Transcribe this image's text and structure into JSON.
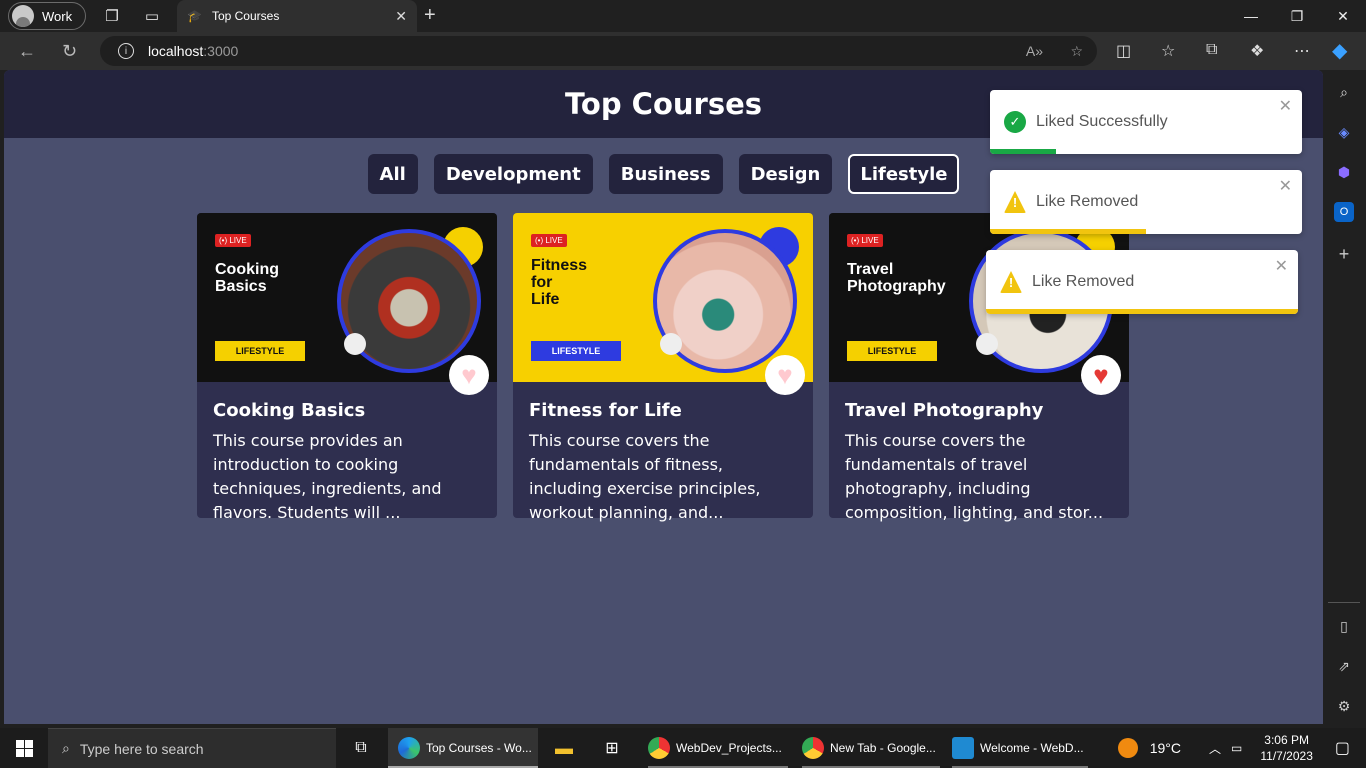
{
  "browser": {
    "profile_label": "Work",
    "tab_title": "Top Courses",
    "url_host": "localhost",
    "url_port": ":3000"
  },
  "page": {
    "title": "Top Courses",
    "filters": [
      "All",
      "Development",
      "Business",
      "Design",
      "Lifestyle"
    ],
    "active_filter": "Lifestyle",
    "courses": [
      {
        "thumb_live": "LIVE",
        "thumb_title_1": "Cooking",
        "thumb_title_2": "Basics",
        "thumb_title_3": "",
        "thumb_tag": "LIFESTYLE",
        "title": "Cooking Basics",
        "description": "This course provides an introduction to cooking techniques, ingredients, and flavors. Students will ...",
        "liked": false
      },
      {
        "thumb_live": "LIVE",
        "thumb_title_1": "Fitness",
        "thumb_title_2": "for",
        "thumb_title_3": "Life",
        "thumb_tag": "LIFESTYLE",
        "title": "Fitness for Life",
        "description": "This course covers the fundamentals of fitness, including exercise principles, workout planning, and...",
        "liked": false
      },
      {
        "thumb_live": "LIVE",
        "thumb_title_1": "Travel",
        "thumb_title_2": "Photography",
        "thumb_title_3": "",
        "thumb_tag": "LIFESTYLE",
        "title": "Travel Photography",
        "description": "This course covers the fundamentals of travel photography, including composition, lighting, and stor...",
        "liked": true
      }
    ]
  },
  "toasts": [
    {
      "message": "Liked Successfully",
      "type": "success",
      "progress": 0.21
    },
    {
      "message": "Like Removed",
      "type": "warning",
      "progress": 0.5
    },
    {
      "message": "Like Removed",
      "type": "warning",
      "progress": 1.0
    }
  ],
  "taskbar": {
    "search_placeholder": "Type here to search",
    "apps": [
      {
        "label": "Top Courses - Wo..."
      },
      {
        "label": "WebDev_Projects..."
      },
      {
        "label": "New Tab - Google..."
      },
      {
        "label": "Welcome - WebD..."
      }
    ],
    "weather": "19°C",
    "time": "3:06 PM",
    "date": "11/7/2023"
  },
  "colors": {
    "header_bg": "#23233d",
    "page_bg": "#4a4f6e",
    "card_bg": "#2f2f4f",
    "success": "#19a845",
    "warning": "#f1c40f",
    "heart_liked": "#e53935",
    "heart_unliked": "#ffc9cf"
  }
}
